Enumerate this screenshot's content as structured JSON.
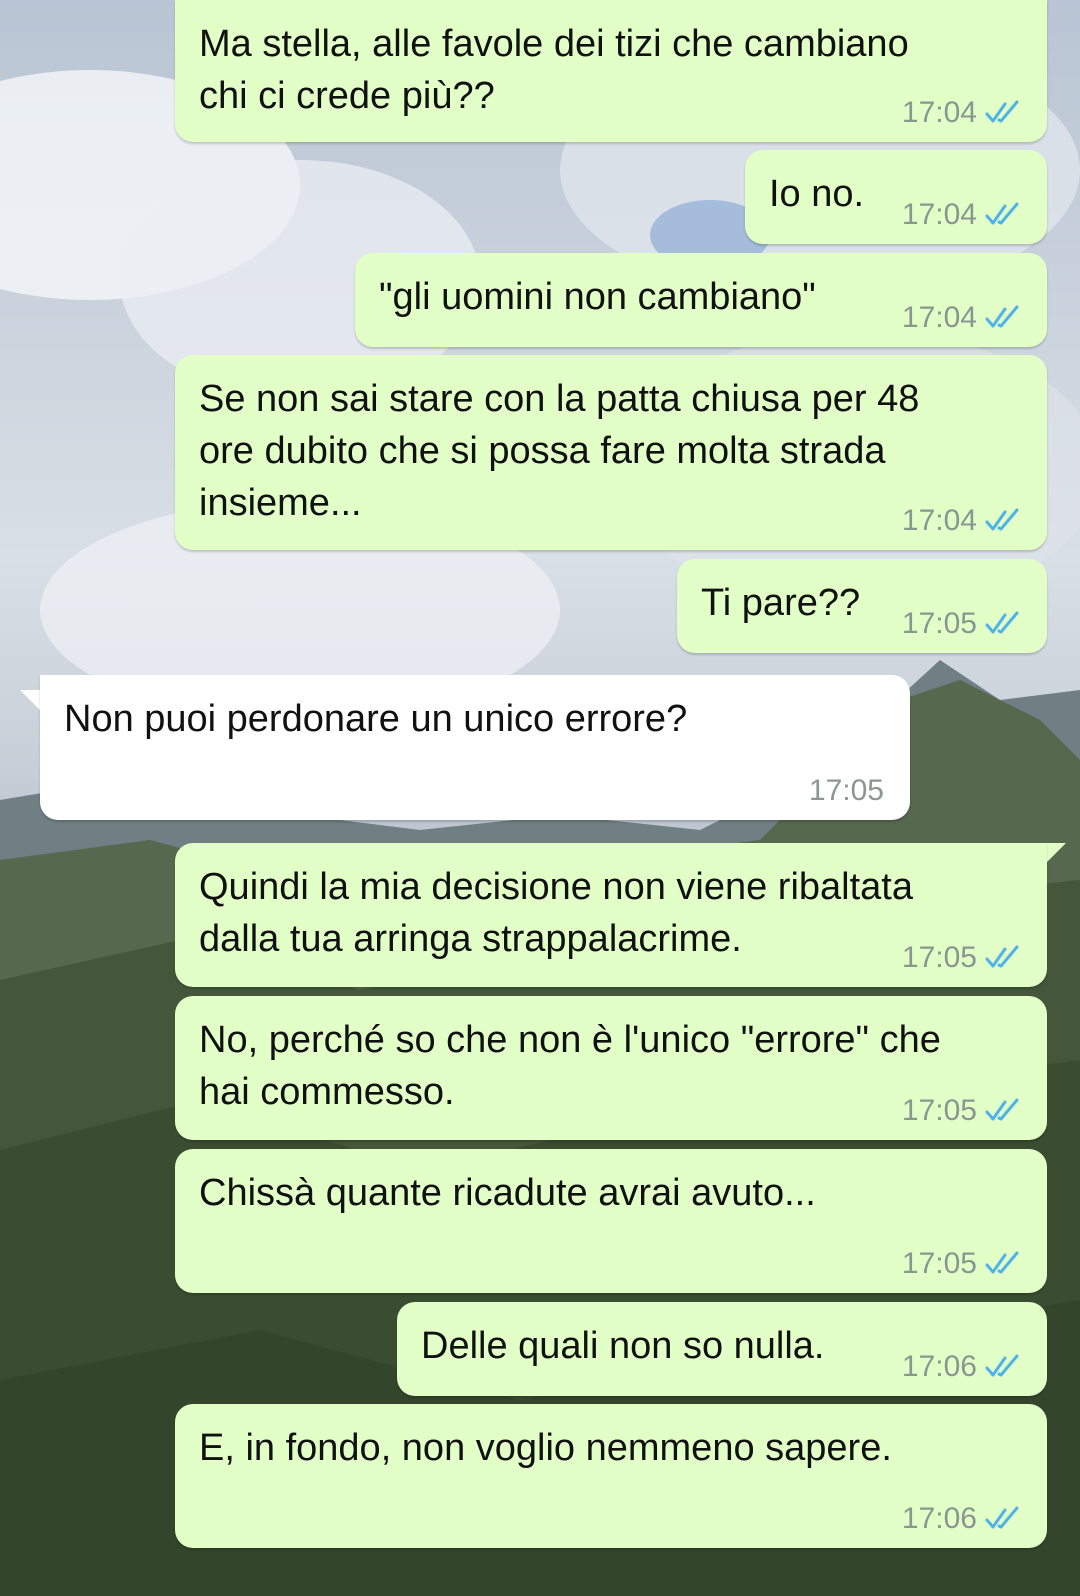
{
  "chat": {
    "messages": [
      {
        "direction": "out",
        "text": "Ma stella, alle favole dei tizi che cambiano\nchi ci crede più??",
        "time": "17:04",
        "status": "read"
      },
      {
        "direction": "out",
        "text": "Io no.",
        "time": "17:04",
        "status": "read"
      },
      {
        "direction": "out",
        "text": "\"gli uomini non cambiano\"",
        "time": "17:04",
        "status": "read"
      },
      {
        "direction": "out",
        "text": "Se non sai stare con la patta chiusa per 48\nore dubito che si possa fare molta strada\ninsieme...",
        "time": "17:04",
        "status": "read"
      },
      {
        "direction": "out",
        "text": "Ti pare??",
        "time": "17:05",
        "status": "read"
      },
      {
        "direction": "in",
        "text": "Non puoi perdonare un unico errore?",
        "time": "17:05"
      },
      {
        "direction": "out",
        "text": "Quindi la mia decisione non viene ribaltata\ndalla tua arringa strappalacrime.",
        "time": "17:05",
        "status": "read"
      },
      {
        "direction": "out",
        "text": "No, perché so che non è l'unico \"errore\" che\nhai commesso.",
        "time": "17:05",
        "status": "read"
      },
      {
        "direction": "out",
        "text": "Chissà quante ricadute avrai avuto...",
        "time": "17:05",
        "status": "read"
      },
      {
        "direction": "out",
        "text": "Delle quali non so nulla.",
        "time": "17:06",
        "status": "read"
      },
      {
        "direction": "out",
        "text": "E, in fondo, non voglio nemmeno sapere.",
        "time": "17:06",
        "status": "read"
      }
    ]
  },
  "colors": {
    "outgoing_bubble": "#e1ffc7",
    "incoming_bubble": "#ffffff",
    "read_ticks": "#4fb3e8",
    "timestamp": "#8a9690"
  },
  "icons": {
    "read_receipt": "double-check-icon"
  }
}
